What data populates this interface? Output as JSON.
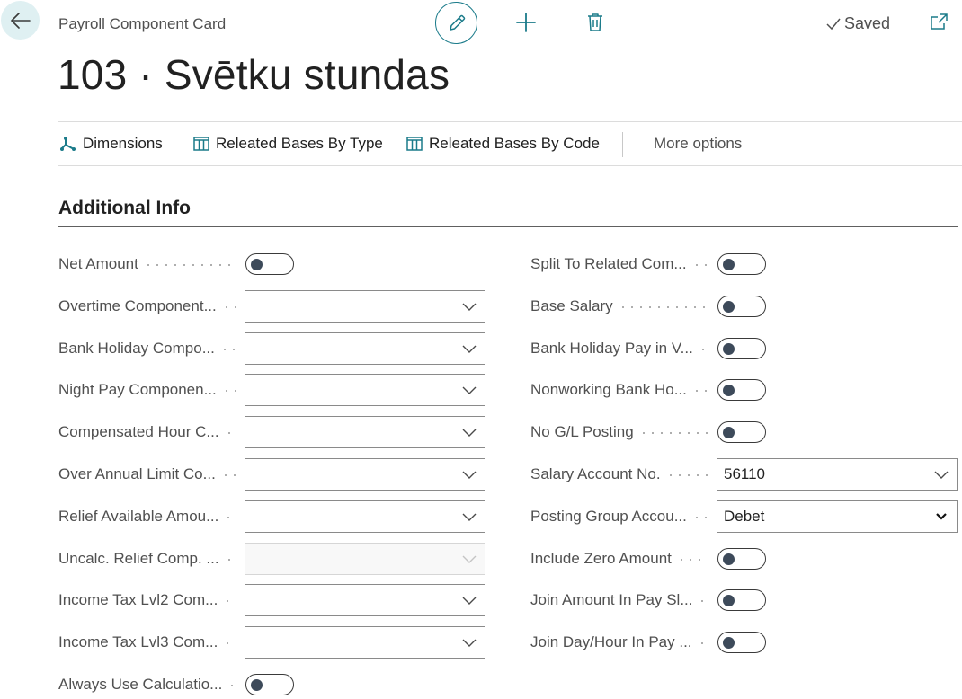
{
  "header": {
    "breadcrumb": "Payroll Component Card",
    "saved_label": "Saved",
    "title": "103 · Svētku stundas"
  },
  "actions": [
    {
      "label": "Dimensions",
      "icon": "dimensions-icon"
    },
    {
      "label": "Releated Bases By Type",
      "icon": "table-icon"
    },
    {
      "label": "Releated Bases By Code",
      "icon": "table-icon"
    },
    {
      "label": "More options",
      "icon": ""
    }
  ],
  "section": {
    "title": "Additional Info"
  },
  "left_fields": [
    {
      "label": "Net Amount",
      "type": "toggle",
      "on": false
    },
    {
      "label": "Overtime Component...",
      "type": "combo",
      "value": ""
    },
    {
      "label": "Bank Holiday Compo...",
      "type": "combo",
      "value": ""
    },
    {
      "label": "Night Pay Componen...",
      "type": "combo",
      "value": ""
    },
    {
      "label": "Compensated Hour C...",
      "type": "combo",
      "value": ""
    },
    {
      "label": "Over Annual Limit Co...",
      "type": "combo",
      "value": ""
    },
    {
      "label": "Relief Available Amou...",
      "type": "combo",
      "value": ""
    },
    {
      "label": "Uncalc. Relief Comp. ...",
      "type": "combo",
      "value": "",
      "disabled": true
    },
    {
      "label": "Income Tax Lvl2 Com...",
      "type": "combo",
      "value": ""
    },
    {
      "label": "Income Tax Lvl3 Com...",
      "type": "combo",
      "value": ""
    },
    {
      "label": "Always Use Calculatio...",
      "type": "toggle",
      "on": false
    }
  ],
  "right_fields": [
    {
      "label": "Split To Related Com...",
      "type": "toggle",
      "on": false
    },
    {
      "label": "Base Salary",
      "type": "toggle",
      "on": false
    },
    {
      "label": "Bank Holiday Pay in V...",
      "type": "toggle",
      "on": false
    },
    {
      "label": "Nonworking Bank Ho...",
      "type": "toggle",
      "on": false
    },
    {
      "label": "No G/L Posting",
      "type": "toggle",
      "on": false
    },
    {
      "label": "Salary Account No.",
      "type": "combo",
      "value": "56110"
    },
    {
      "label": "Posting Group Accou...",
      "type": "select",
      "value": "Debet"
    },
    {
      "label": "Include Zero Amount",
      "type": "toggle",
      "on": false
    },
    {
      "label": "Join Amount In Pay Sl...",
      "type": "toggle",
      "on": false
    },
    {
      "label": "Join Day/Hour In Pay ...",
      "type": "toggle",
      "on": false
    }
  ]
}
